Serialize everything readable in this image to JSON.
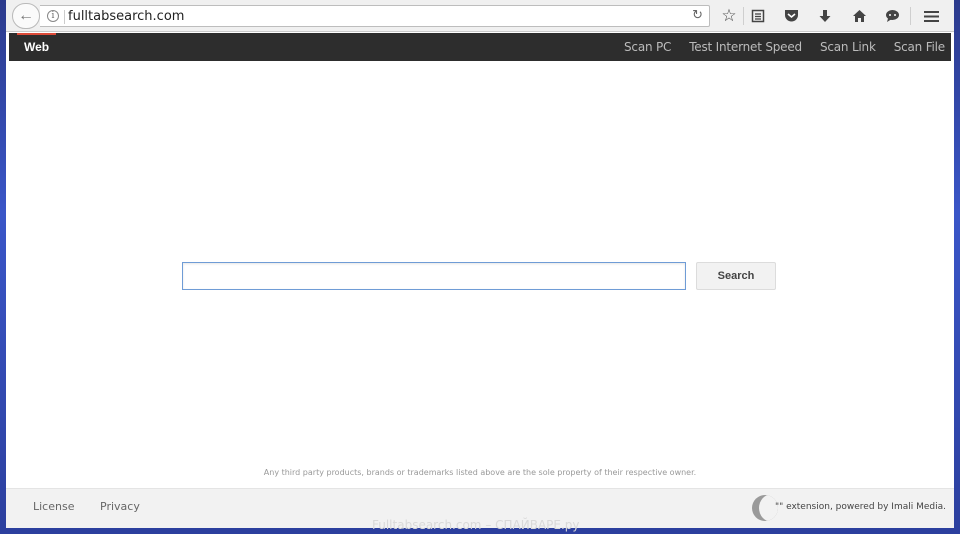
{
  "browser": {
    "url": "fulltabsearch.com",
    "icons": [
      "back-arrow-icon",
      "info-icon",
      "reload-icon",
      "bookmark-star-icon",
      "reading-list-icon",
      "pocket-icon",
      "download-icon",
      "home-icon",
      "chat-icon",
      "hamburger-menu-icon"
    ]
  },
  "navbar": {
    "active_tab": "Web",
    "links": [
      "Scan PC",
      "Test Internet Speed",
      "Scan Link",
      "Scan File"
    ],
    "accent_color": "#dd4b39"
  },
  "search": {
    "input_value": "",
    "button_label": "Search"
  },
  "disclaimer": "Any third party products, brands or trademarks listed above are the sole property of their respective owner.",
  "footer": {
    "links": [
      "License",
      "Privacy"
    ],
    "powered_by": "\"\" extension, powered by Imali Media."
  },
  "watermark": "Fulltabsearch.com – СПАЙВАРЕ.ру"
}
